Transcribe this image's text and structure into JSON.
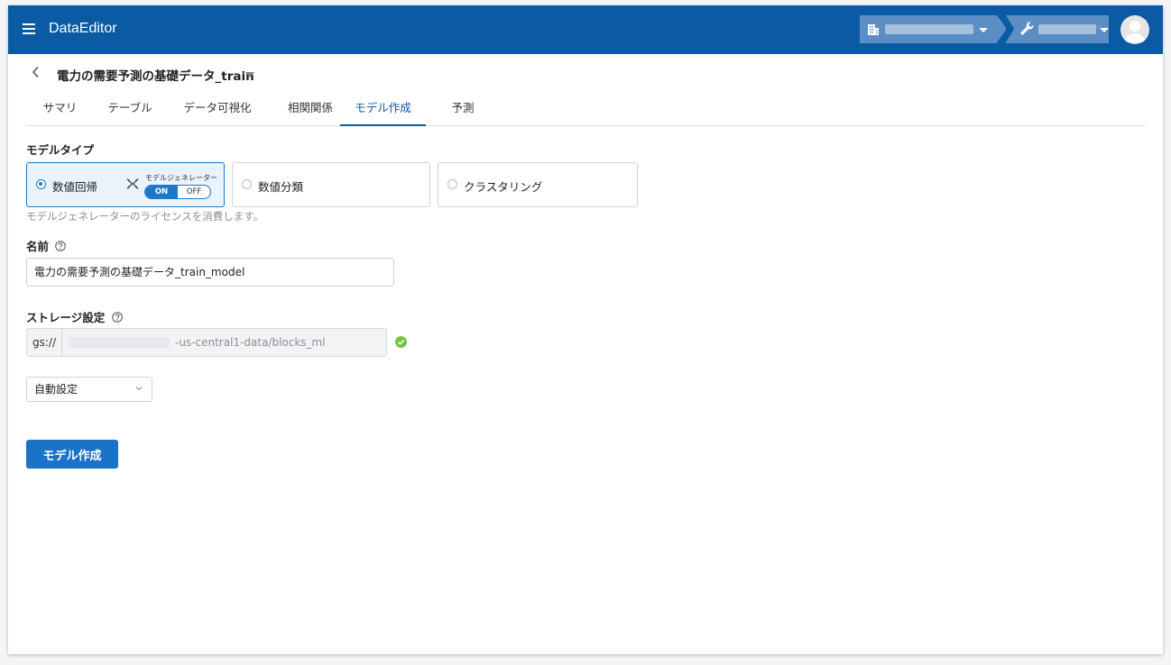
{
  "header": {
    "app_title": "DataEditor",
    "org_icon": "building-icon",
    "tool_icon": "wrench-icon",
    "avatar_icon": "user-avatar-icon",
    "brand_color": "#0a5aa4"
  },
  "dataset": {
    "title": "電力の需要予測の基礎データ_train"
  },
  "tabs": [
    {
      "label": "サマリ"
    },
    {
      "label": "テーブル"
    },
    {
      "label": "データ可視化"
    },
    {
      "label": "相関関係"
    },
    {
      "label": "モデル作成"
    },
    {
      "label": "予測"
    }
  ],
  "active_tab": "モデル作成",
  "model_type": {
    "label": "モデルタイプ",
    "options": [
      {
        "label": "数値回帰"
      },
      {
        "label": "数値分類"
      },
      {
        "label": "クラスタリング"
      }
    ],
    "selected": "数値回帰",
    "generator": {
      "label": "モデルジェネレーター",
      "on_label": "ON",
      "off_label": "OFF",
      "state": "ON"
    },
    "hint": "モデルジェネレーターのライセンスを消費します。"
  },
  "name_field": {
    "label": "名前",
    "value": "電力の需要予測の基礎データ_train_model"
  },
  "storage": {
    "label": "ストレージ設定",
    "prefix": "gs://",
    "path_suffix": "-us-central1-data/blocks_ml",
    "status_color": "#7ac143"
  },
  "storage_mode": {
    "value": "自動設定"
  },
  "actions": {
    "create_label": "モデル作成"
  }
}
